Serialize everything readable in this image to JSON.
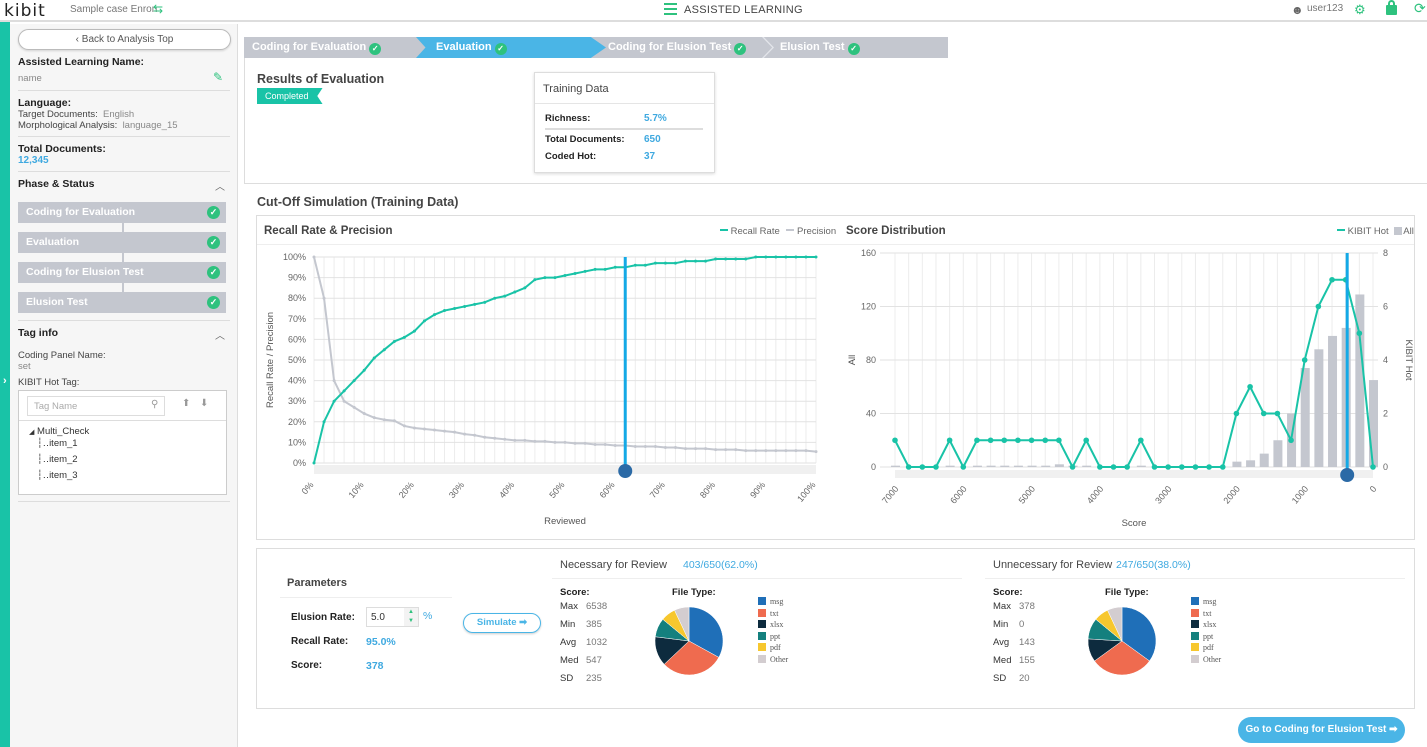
{
  "header": {
    "logo": "kibit",
    "case_name": "Sample case Enron",
    "app_title": "ASSISTED LEARNING",
    "user": "user123",
    "icons": [
      "swap-icon",
      "menu-icon",
      "user-icon",
      "gear-icon",
      "lock-icon",
      "logout-icon"
    ]
  },
  "sidebar": {
    "back_label": "Back to Analysis Top",
    "name_label": "Assisted Learning Name:",
    "name_value": "name",
    "language_label": "Language:",
    "target_docs_label": "Target Documents:",
    "target_docs_value": "English",
    "morph_label": "Morphological Analysis:",
    "morph_value": "language_15",
    "total_docs_label": "Total Documents:",
    "total_docs_value": "12,345",
    "phase_title": "Phase & Status",
    "phases": [
      {
        "label": "Coding for Evaluation",
        "done": true
      },
      {
        "label": "Evaluation",
        "done": true
      },
      {
        "label": "Coding for Elusion Test",
        "done": true
      },
      {
        "label": "Elusion Test",
        "done": true
      }
    ],
    "tag_title": "Tag info",
    "coding_panel_label": "Coding Panel Name:",
    "coding_panel_value": "set",
    "hot_tag_label": "KIBIT Hot Tag:",
    "tag_search_placeholder": "Tag Name",
    "tree": {
      "root": "Multi_Check",
      "items": [
        "item_1",
        "item_2",
        "item_3"
      ]
    }
  },
  "steps": [
    {
      "label": "Coding for Evaluation",
      "active": false
    },
    {
      "label": "Evaluation",
      "active": true
    },
    {
      "label": "Coding for Elusion Test",
      "active": false
    },
    {
      "label": "Elusion Test",
      "active": false
    }
  ],
  "results": {
    "title": "Results of Evaluation",
    "status": "Completed",
    "training": {
      "title": "Training Data",
      "richness_label": "Richness:",
      "richness": "5.7%",
      "total_label": "Total Documents:",
      "total": "650",
      "hot_label": "Coded Hot:",
      "hot": "37"
    }
  },
  "cutoff": {
    "title": "Cut-Off Simulation (Training Data)"
  },
  "colors": {
    "accent": "#19c3a7",
    "blue": "#3fa9e0",
    "cutoff": "#14a9e6",
    "gray": "#c4c7cf"
  },
  "chart_data": [
    {
      "type": "line",
      "title": "Recall Rate & Precision",
      "xlabel": "Reviewed",
      "ylabel": "Recall Rate / Precision",
      "xlim": [
        0,
        100
      ],
      "ylim": [
        0,
        100
      ],
      "unit": "%",
      "grid": true,
      "legend": "top-right",
      "x_ticks": [
        "0%",
        "10%",
        "20%",
        "30%",
        "40%",
        "50%",
        "60%",
        "70%",
        "80%",
        "90%",
        "100%"
      ],
      "y_ticks": [
        "0%",
        "10%",
        "20%",
        "30%",
        "40%",
        "50%",
        "60%",
        "70%",
        "80%",
        "90%",
        "100%"
      ],
      "x": [
        0,
        2,
        4,
        6,
        8,
        10,
        12,
        14,
        16,
        18,
        20,
        22,
        24,
        26,
        28,
        30,
        32,
        34,
        36,
        38,
        40,
        42,
        44,
        46,
        48,
        50,
        52,
        54,
        56,
        58,
        60,
        62,
        64,
        66,
        68,
        70,
        72,
        74,
        76,
        78,
        80,
        82,
        84,
        86,
        88,
        90,
        92,
        94,
        96,
        98,
        100
      ],
      "series": [
        {
          "name": "Recall Rate",
          "color": "#19c3a7",
          "values": [
            0,
            20,
            30,
            35,
            40,
            45,
            51,
            55,
            59,
            61,
            64,
            69,
            72,
            74,
            75,
            76,
            77,
            78,
            80,
            81,
            83,
            85,
            89,
            90,
            90,
            91,
            92,
            93,
            94,
            94,
            95,
            95,
            96,
            96,
            97,
            97,
            97,
            98,
            98,
            98,
            99,
            99,
            99,
            99,
            100,
            100,
            100,
            100,
            100,
            100,
            100
          ]
        },
        {
          "name": "Precision",
          "color": "#c4c7cf",
          "values": [
            100,
            80,
            40,
            30,
            27,
            24,
            22,
            21,
            20.5,
            18,
            17,
            16.5,
            16,
            15.5,
            15,
            14,
            13.5,
            12.5,
            12,
            11.5,
            11,
            11,
            10.5,
            10.5,
            10,
            10,
            9.5,
            9.5,
            9,
            9,
            8.5,
            8.5,
            8,
            8,
            8,
            7.5,
            7.5,
            7,
            7,
            7,
            6.5,
            6.5,
            6.5,
            6,
            6,
            6,
            6,
            6,
            6,
            6,
            5.5
          ]
        }
      ],
      "cutoff_x": 62
    },
    {
      "type": "bar+line",
      "title": "Score Distribution",
      "xlabel": "Score",
      "ylabel_left": "All",
      "ylabel_right": "KIBIT Hot",
      "ylim_left": [
        0,
        160
      ],
      "ylim_right": [
        0,
        8
      ],
      "grid": true,
      "legend": "top-right",
      "x_reversed": true,
      "x_ticks": [
        "7000",
        "6000",
        "5000",
        "4000",
        "3000",
        "2000",
        "1000",
        "0"
      ],
      "y_ticks_left": [
        "0",
        "40",
        "80",
        "120",
        "160"
      ],
      "y_ticks_right": [
        "0",
        "2",
        "4",
        "6",
        "8"
      ],
      "x": [
        7000,
        6800,
        6600,
        6400,
        6200,
        6000,
        5800,
        5600,
        5400,
        5200,
        5000,
        4800,
        4600,
        4400,
        4200,
        4000,
        3800,
        3600,
        3400,
        3200,
        3000,
        2800,
        2600,
        2400,
        2200,
        2000,
        1800,
        1600,
        1400,
        1200,
        1000,
        800,
        600,
        400,
        200,
        0
      ],
      "series": [
        {
          "name": "All",
          "type": "bar",
          "axis": "left",
          "color": "#c4c7cf",
          "values": [
            1,
            0,
            0,
            0,
            1,
            0,
            1,
            1,
            1,
            1,
            1,
            1,
            2,
            1,
            1,
            0,
            0,
            0,
            1,
            0,
            0,
            0,
            0,
            0,
            0,
            4,
            5,
            10,
            20,
            40,
            74,
            88,
            98,
            104,
            129,
            65
          ]
        },
        {
          "name": "KIBIT Hot",
          "type": "line",
          "axis": "right",
          "color": "#19c3a7",
          "values": [
            1,
            0,
            0,
            0,
            1,
            0,
            1,
            1,
            1,
            1,
            1,
            1,
            1,
            0,
            1,
            0,
            0,
            0,
            1,
            0,
            0,
            0,
            0,
            0,
            0,
            2,
            3,
            2,
            2,
            1,
            4,
            6,
            7,
            7,
            5,
            0
          ]
        }
      ],
      "cutoff_x": 378
    },
    {
      "type": "pie",
      "title": "File Type:",
      "group": "Necessary for Review",
      "categories": [
        "msg",
        "txt",
        "xlsx",
        "ppt",
        "pdf",
        "Other"
      ],
      "values": [
        33,
        30,
        14,
        9,
        7,
        7
      ]
    },
    {
      "type": "pie",
      "title": "File Type:",
      "group": "Unnecessary for Review",
      "categories": [
        "msg",
        "txt",
        "xlsx",
        "ppt",
        "pdf",
        "Other"
      ],
      "values": [
        35,
        30,
        11,
        10,
        7,
        7
      ]
    }
  ],
  "pie_colors": [
    "#1f6fb8",
    "#ef6b4f",
    "#0d2b3e",
    "#14807e",
    "#f7c72e",
    "#d3cdd0"
  ],
  "params": {
    "title": "Parameters",
    "elusion_label": "Elusion Rate:",
    "elusion_value": "5.0",
    "elusion_unit": "%",
    "recall_label": "Recall Rate:",
    "recall_value": "95.0%",
    "score_label": "Score:",
    "score_value": "378",
    "simulate_label": "Simulate"
  },
  "necessary": {
    "title": "Necessary for Review",
    "count": "403/650(62.0%)",
    "score_label": "Score:",
    "filetype_label": "File Type:",
    "stats": [
      {
        "k": "Max",
        "v": "6538"
      },
      {
        "k": "Min",
        "v": "385"
      },
      {
        "k": "Avg",
        "v": "1032"
      },
      {
        "k": "Med",
        "v": "547"
      },
      {
        "k": "SD",
        "v": "235"
      }
    ]
  },
  "unnecessary": {
    "title": "Unnecessary for Review",
    "count": "247/650(38.0%)",
    "score_label": "Score:",
    "filetype_label": "File Type:",
    "stats": [
      {
        "k": "Max",
        "v": "378"
      },
      {
        "k": "Min",
        "v": "0"
      },
      {
        "k": "Avg",
        "v": "143"
      },
      {
        "k": "Med",
        "v": "155"
      },
      {
        "k": "SD",
        "v": "20"
      }
    ]
  },
  "go_label": "Go to Coding for Elusion Test"
}
